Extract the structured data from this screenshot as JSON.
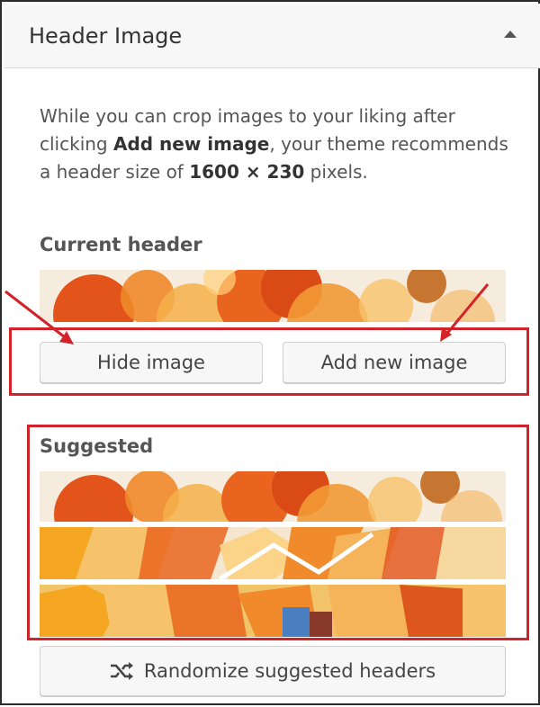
{
  "section": {
    "title": "Header Image"
  },
  "description": {
    "part1": "While you can crop images to your liking after clicking ",
    "bold1": "Add new image",
    "part2": ", your theme recommends a header size of ",
    "bold2": "1600 × 230",
    "part3": " pixels."
  },
  "current_header": {
    "label": "Current header"
  },
  "buttons": {
    "hide_image": "Hide image",
    "add_new_image": "Add new image",
    "randomize": "Randomize suggested headers"
  },
  "suggested": {
    "label": "Suggested"
  },
  "icons": {
    "collapse": "triangle-up-icon",
    "randomize": "shuffle-icon"
  },
  "colors": {
    "annotation": "#d2232a",
    "accent_orange": "#e8601c",
    "accent_amber": "#f5a623"
  }
}
